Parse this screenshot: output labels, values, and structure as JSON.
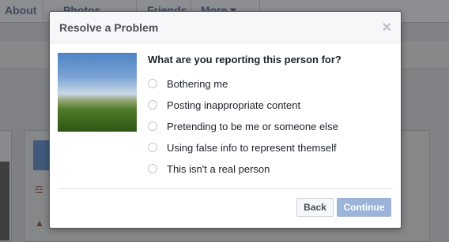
{
  "background": {
    "tabs": [
      {
        "label": "About"
      },
      {
        "label": "Photos"
      },
      {
        "label": "Friends"
      },
      {
        "label": "More ▾"
      }
    ]
  },
  "modal": {
    "title": "Resolve a Problem",
    "close_icon": "close-icon",
    "question": "What are you reporting this person for?",
    "options": [
      {
        "label": "Bothering me",
        "selected": false
      },
      {
        "label": "Posting inappropriate content",
        "selected": false
      },
      {
        "label": "Pretending to be me or someone else",
        "selected": false
      },
      {
        "label": "Using false info to represent themself",
        "selected": false
      },
      {
        "label": "This isn't a real person",
        "selected": false
      }
    ],
    "buttons": {
      "back": "Back",
      "continue": "Continue"
    }
  },
  "colors": {
    "overlay": "#7f8184",
    "primary_disabled": "#9cb4d8",
    "header_bg": "#f6f7f9"
  }
}
